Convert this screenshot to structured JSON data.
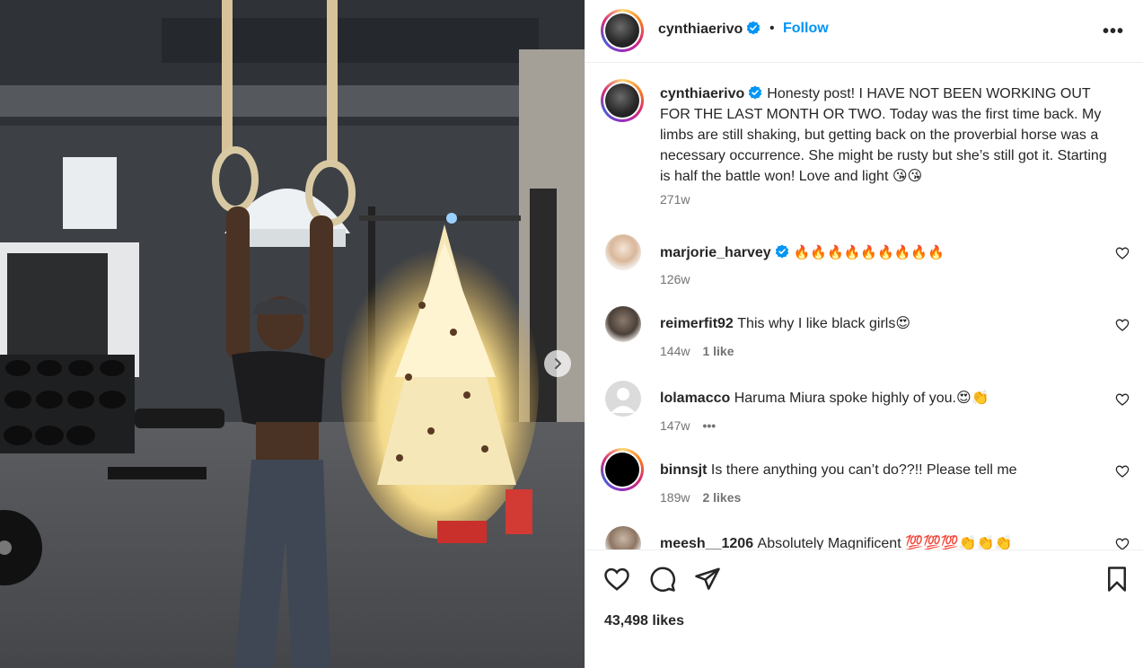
{
  "post": {
    "username": "cynthiaerivo",
    "separator": "•",
    "follow_label": "Follow",
    "more_label": "•••",
    "caption": "Honesty post! I HAVE NOT BEEN WORKING OUT FOR THE LAST MONTH OR TWO. Today was the first time back. My limbs are still shaking, but getting back on the proverbial horse was a necessary occurrence. She might be rusty but she’s still got it. Starting is half the battle won! Love and light 😘😘",
    "caption_time": "271w",
    "likes_count": "43,498 likes"
  },
  "comments": [
    {
      "username": "marjorie_harvey",
      "verified": true,
      "text": "🔥🔥🔥🔥🔥🔥🔥🔥🔥",
      "time": "126w",
      "likes": "",
      "extra": ""
    },
    {
      "username": "reimerfit92",
      "verified": false,
      "text": "This why I like black girls😍",
      "time": "144w",
      "likes": "1 like",
      "extra": ""
    },
    {
      "username": "lolamacco",
      "verified": false,
      "text": "Haruma Miura spoke highly of you.😍👏",
      "time": "147w",
      "likes": "",
      "extra": "•••"
    },
    {
      "username": "binnsjt",
      "verified": false,
      "text": "Is there anything you can’t do??!! Please tell me",
      "time": "189w",
      "likes": "2 likes",
      "extra": ""
    },
    {
      "username": "meesh__1206",
      "verified": false,
      "text": "Absolutely Magnificent 💯💯💯👏👏👏",
      "time": "",
      "likes": "",
      "extra": ""
    }
  ],
  "icons": {
    "heart": "heart-icon",
    "comment": "comment-icon",
    "share": "share-icon",
    "save": "bookmark-icon",
    "next": "chevron-right-icon",
    "verified": "verified-badge-icon"
  },
  "colors": {
    "accent": "#0095f6",
    "text": "#262626",
    "muted": "#737373",
    "verified": "#0095f6"
  }
}
